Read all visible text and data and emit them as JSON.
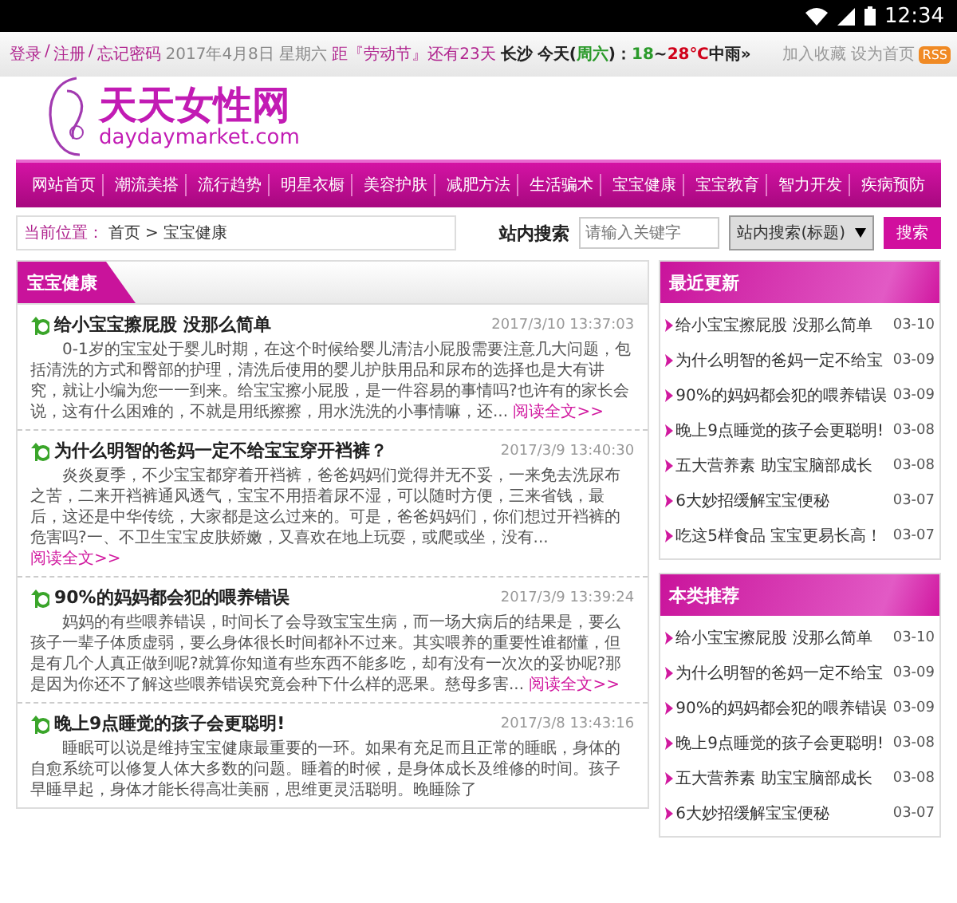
{
  "status_bar": {
    "time": "12:34"
  },
  "top_bar": {
    "account_links": [
      "登录",
      "注册",
      "忘记密码"
    ],
    "separator": "/",
    "date": "2017年4月8日 星期六",
    "countdown": "距『劳动节』还有23天",
    "city": "长沙",
    "weather": [
      {
        "text": "今天(",
        "color": "#222222"
      },
      {
        "text": "周六",
        "color": "#2a9a2a"
      },
      {
        "text": ")：",
        "color": "#222222"
      },
      {
        "text": "18",
        "color": "#2a9a2a"
      },
      {
        "text": "~",
        "color": "#222222"
      },
      {
        "text": "28℃",
        "color": "#d0021b"
      },
      {
        "text": "中雨",
        "color": "#222222"
      },
      {
        "text": "»",
        "color": "#222222"
      }
    ],
    "right_links": [
      "加入收藏",
      "设为首页"
    ],
    "rss_badge": "RSS"
  },
  "logo": {
    "title": "天天女性网",
    "domain": "daydaymarket.com"
  },
  "nav": [
    "网站首页",
    "潮流美搭",
    "流行趋势",
    "明星衣橱",
    "美容护肤",
    "减肥方法",
    "生活骗术",
    "宝宝健康",
    "宝宝教育",
    "智力开发",
    "疾病预防"
  ],
  "breadcrumb": {
    "label": "当前位置：",
    "path": [
      "首页",
      "宝宝健康"
    ],
    "separator": ">"
  },
  "search": {
    "label": "站内搜索",
    "placeholder": "请输入关键字",
    "scope": "站内搜索(标题)",
    "button": "搜索"
  },
  "section": {
    "title": "宝宝健康",
    "articles": [
      {
        "title": "给小宝宝擦屁股 没那么简单",
        "date": "2017/3/10 13:37:03",
        "body": "0-1岁的宝宝处于婴儿时期，在这个时候给婴儿清洁小屁股需要注意几大问题，包括清洗的方式和臀部的护理，清洗后使用的婴儿护肤用品和尿布的选择也是大有讲究，就让小编为您一一到来。给宝宝擦小屁股，是一件容易的事情吗?也许有的家长会说，这有什么困难的，不就是用纸擦擦，用水洗洗的小事情嘛，还...",
        "more": "阅读全文>>"
      },
      {
        "title": "为什么明智的爸妈一定不给宝宝穿开裆裤？",
        "date": "2017/3/9 13:40:30",
        "body": "炎炎夏季，不少宝宝都穿着开裆裤，爸爸妈妈们觉得并无不妥，一来免去洗尿布之苦，二来开裆裤通风透气，宝宝不用捂着尿不湿，可以随时方便，三来省钱，最后，这还是中华传统，大家都是这么过来的。可是，爸爸妈妈们，你们想过开裆裤的危害吗?一、不卫生宝宝皮肤娇嫩，又喜欢在地上玩耍，或爬或坐，没有...",
        "more": "阅读全文>>"
      },
      {
        "title": "90%的妈妈都会犯的喂养错误",
        "date": "2017/3/9 13:39:24",
        "body": "妈妈的有些喂养错误，时间长了会导致宝宝生病，而一场大病后的结果是，要么孩子一辈子体质虚弱，要么身体很长时间都补不过来。其实喂养的重要性谁都懂，但是有几个人真正做到呢?就算你知道有些东西不能多吃，却有没有一次次的妥协呢?那是因为你还不了解这些喂养错误究竟会种下什么样的恶果。慈母多害...",
        "more": "阅读全文>>"
      },
      {
        "title": "晚上9点睡觉的孩子会更聪明!",
        "date": "2017/3/8 13:43:16",
        "body": "睡眠可以说是维持宝宝健康最重要的一环。如果有充足而且正常的睡眠，身体的自愈系统可以修复人体大多数的问题。睡着的时候，是身体成长及维修的时间。孩子早睡早起，身体才能长得高壮美丽，思维更灵活聪明。晚睡除了"
      }
    ]
  },
  "sidebar": [
    {
      "title": "最近更新",
      "items": [
        {
          "title": "给小宝宝擦屁股 没那么简单",
          "date": "03-10"
        },
        {
          "title": "为什么明智的爸妈一定不给宝",
          "date": "03-09"
        },
        {
          "title": "90%的妈妈都会犯的喂养错误",
          "date": "03-09"
        },
        {
          "title": "晚上9点睡觉的孩子会更聪明!",
          "date": "03-08"
        },
        {
          "title": "五大营养素 助宝宝脑部成长",
          "date": "03-08"
        },
        {
          "title": "6大妙招缓解宝宝便秘",
          "date": "03-07"
        },
        {
          "title": "吃这5样食品 宝宝更易长高！",
          "date": "03-07"
        }
      ]
    },
    {
      "title": "本类推荐",
      "items": [
        {
          "title": "给小宝宝擦屁股 没那么简单",
          "date": "03-10"
        },
        {
          "title": "为什么明智的爸妈一定不给宝",
          "date": "03-09"
        },
        {
          "title": "90%的妈妈都会犯的喂养错误",
          "date": "03-09"
        },
        {
          "title": "晚上9点睡觉的孩子会更聪明!",
          "date": "03-08"
        },
        {
          "title": "五大营养素 助宝宝脑部成长",
          "date": "03-08"
        },
        {
          "title": "6大妙招缓解宝宝便秘",
          "date": "03-07"
        }
      ]
    }
  ]
}
